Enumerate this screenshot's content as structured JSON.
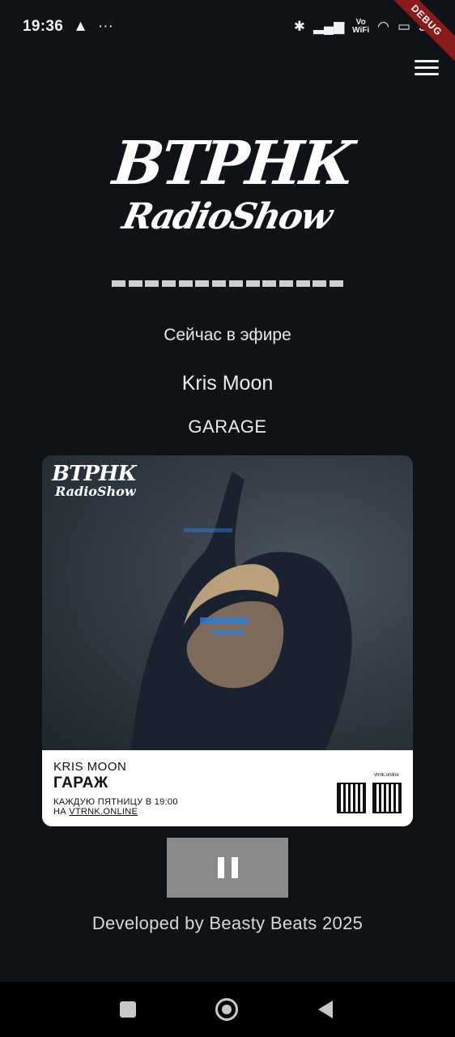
{
  "status_bar": {
    "time": "19:36",
    "vo_wifi": "Vo\nWiFi",
    "battery": "39",
    "debug": "DEBUG"
  },
  "logo": {
    "top": "ВТРНК",
    "bottom": "RadioShow"
  },
  "now_playing": {
    "label": "Сейчас в эфире",
    "artist": "Kris Moon",
    "show": "GARAGE"
  },
  "cover": {
    "logo_top": "ВТРНК",
    "logo_bottom": "RadioShow",
    "artist": "KRIS MOON",
    "show": "ГАРАЖ",
    "schedule": "КАЖДУЮ ПЯТНИЦУ В 19:00",
    "site_prefix": "НА ",
    "site": "VTRNK.ONLINE",
    "qr_label": "vtrnk.online"
  },
  "footer": {
    "credit": "Developed by Beasty Beats 2025"
  },
  "icons": {
    "menu": "hamburger-icon",
    "pause": "pause-icon",
    "nav_recents": "square-icon",
    "nav_home": "circle-icon",
    "nav_back": "triangle-back-icon"
  }
}
